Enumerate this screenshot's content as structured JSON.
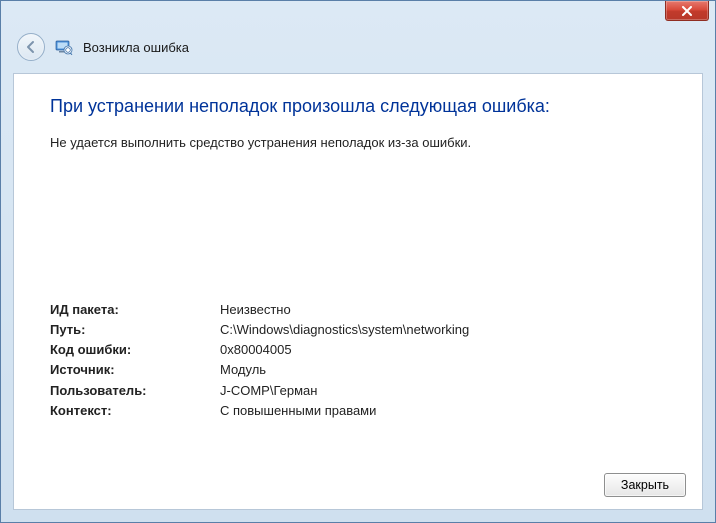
{
  "window": {
    "title": "Возникла ошибка"
  },
  "main": {
    "heading": "При устранении неполадок произошла следующая ошибка:",
    "message": "Не удается выполнить средство устранения неполадок из-за ошибки."
  },
  "details": {
    "packageId": {
      "label": "ИД пакета:",
      "value": "Неизвестно"
    },
    "path": {
      "label": "Путь:",
      "value": "C:\\Windows\\diagnostics\\system\\networking"
    },
    "errorCode": {
      "label": "Код ошибки:",
      "value": "0x80004005"
    },
    "source": {
      "label": "Источник:",
      "value": "Модуль"
    },
    "user": {
      "label": "Пользователь:",
      "value": "J-COMP\\Герман"
    },
    "context": {
      "label": "Контекст:",
      "value": "С повышенными правами"
    }
  },
  "buttons": {
    "close": "Закрыть"
  }
}
